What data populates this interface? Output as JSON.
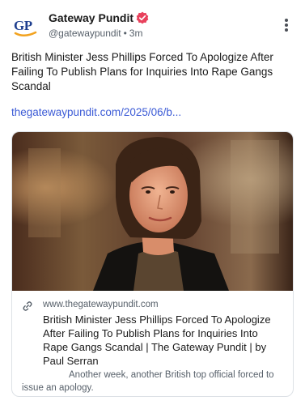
{
  "post": {
    "author_name": "Gateway Pundit",
    "handle": "@gatewaypundit",
    "separator": "•",
    "time": "3m",
    "text": "British Minister Jess Phillips Forced To Apologize After Failing To Publish Plans for Inquiries Into Rape Gangs Scandal",
    "link_text": "thegatewaypundit.com/2025/06/b...",
    "avatar_text": "GP"
  },
  "card": {
    "domain": "www.thegatewaypundit.com",
    "title": "British Minister Jess Phillips Forced To Apologize After Failing To Publish Plans for Inquiries Into Rape Gangs Scandal | The Gateway Pundit | by Paul Serran",
    "description": "Another week, another British top official forced to issue an apology."
  },
  "colors": {
    "link": "#3c5bd6",
    "verified": "#e8415c",
    "avatar_text": "#1f3f8f",
    "avatar_swoosh": "#f2a21e"
  },
  "icons": {
    "verified": "verified-badge-icon",
    "more": "more-vertical-icon",
    "link": "link-icon"
  }
}
